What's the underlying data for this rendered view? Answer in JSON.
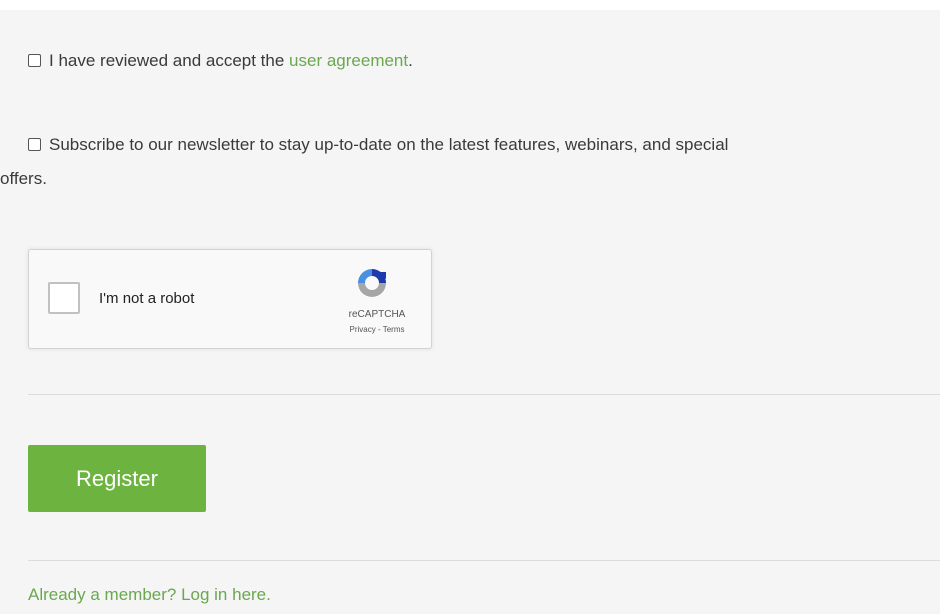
{
  "form": {
    "terms": {
      "text": "I have reviewed and accept the ",
      "link_text": "user agreement",
      "suffix": "."
    },
    "newsletter": {
      "line1": "Subscribe to our newsletter to stay up-to-date on the latest features, webinars, and special",
      "line2": "offers."
    },
    "captcha": {
      "label": "I'm not a robot",
      "brand": "reCAPTCHA",
      "privacy": "Privacy",
      "separator": " - ",
      "terms": "Terms",
      "icon": "recaptcha-logo-icon"
    },
    "register_label": "Register",
    "login_link": "Already a member? Log in here.",
    "colors": {
      "accent": "#6db33f",
      "link": "#6aa84f",
      "background": "#f5f5f5"
    }
  }
}
